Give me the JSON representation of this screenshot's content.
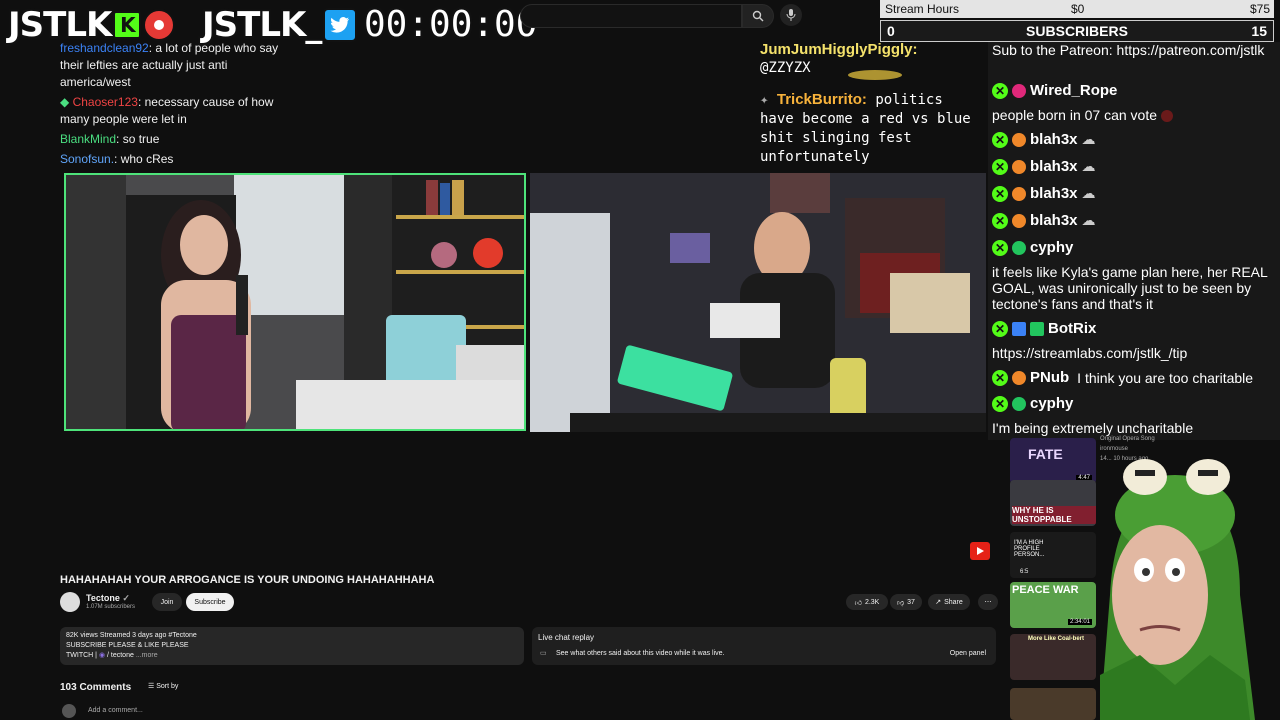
{
  "overlay": {
    "brand_left": "JSTLK",
    "brand_right": "JSTLK_",
    "timer": "00:00:00",
    "stream_hours_label": "Stream Hours",
    "stream_hours_min": "$0",
    "stream_hours_max": "$75",
    "subs_count": "0",
    "subs_label": "SUBSCRIBERS",
    "subs_goal": "15"
  },
  "left_chat": [
    {
      "user": "freshandclean92",
      "text": ": a lot of people who say their lefties are actually just anti america/west",
      "color": "#3b82f6"
    },
    {
      "user": "Chaoser123",
      "text": ": necessary cause of how many people were let in",
      "color": "#ef4444"
    },
    {
      "user": "BlankMind",
      "text": ": so true",
      "color": "#4ade80"
    },
    {
      "user": "Sonofsun.",
      "text": ": who cRes",
      "color": "#60a5fa"
    }
  ],
  "center_chat": {
    "user1": "JumJumHigglyPiggly:",
    "text1": "@ZZYZX",
    "user2": "TrickBurrito:",
    "text2a": "politics",
    "text2b": "have become a red vs blue shit slinging fest unfortunately"
  },
  "right_chat": {
    "pinned": "Sub to the Patreon: https://patreon.com/jstlk",
    "messages": [
      {
        "user": "Wired_Rope",
        "text": "",
        "dot": "#e0287a"
      },
      {
        "user": "",
        "text": "people born in 07 can vote"
      },
      {
        "user": "blah3x",
        "text": "",
        "dot": "#f0882a"
      },
      {
        "user": "blah3x",
        "text": "",
        "dot": "#f0882a"
      },
      {
        "user": "blah3x",
        "text": "",
        "dot": "#f0882a"
      },
      {
        "user": "blah3x",
        "text": "",
        "dot": "#f0882a"
      },
      {
        "user": "cyphy",
        "text": "",
        "dot": "#22c55e"
      },
      {
        "user": "",
        "text": "it feels like Kyla's game plan here, her REAL GOAL, was unironically just to be seen by tectone's fans and that's it"
      },
      {
        "user": "BotRix",
        "text": "",
        "dot": "#3b82f6"
      },
      {
        "user": "",
        "text": "https://streamlabs.com/jstlk_/tip"
      },
      {
        "user": "PNub",
        "text": "I think you are too charitable",
        "dot": "#f0882a"
      },
      {
        "user": "cyphy",
        "text": "",
        "dot": "#22c55e"
      },
      {
        "user": "",
        "text": "I'm being extremely uncharitable"
      }
    ]
  },
  "video": {
    "title": "HAHAHAHAH YOUR ARROGANCE IS YOUR UNDOING HAHAHAHHAHA",
    "channel": "Tectone",
    "subscribers": "1.07M subscribers",
    "join": "Join",
    "subscribe": "Subscribe",
    "likes": "2.3K",
    "dislikes": "37",
    "share": "Share",
    "meta": "82K views  Streamed 3 days ago  #Tectone",
    "desc_line2": "SUBSCRIBE PLEASE & LIKE PLEASE",
    "desc_line3": "TWITCH |",
    "desc_link": "/ tectone",
    "more": "...more",
    "live_chat_replay": "Live chat replay",
    "live_chat_desc": "See what others said about this video while it was live.",
    "open_panel": "Open panel",
    "comments_count": "103 Comments",
    "sort_by": "Sort by",
    "add_comment": "Add a comment..."
  },
  "recommended": [
    {
      "label": "FATE",
      "meta": "4:47"
    },
    {
      "label": "WHY HE IS UNSTOPPABLE",
      "meta": ""
    },
    {
      "label": "I'M A HIGH PROFILE PERSON...",
      "meta": "6:5"
    },
    {
      "label": "PEACE WAR",
      "meta": "2:34:01"
    },
    {
      "label": "More Like Coal-bert",
      "meta": ""
    }
  ],
  "recommended_side_text": [
    "Original Opera Song",
    "ironmouse",
    "14... 10 hours ago"
  ]
}
